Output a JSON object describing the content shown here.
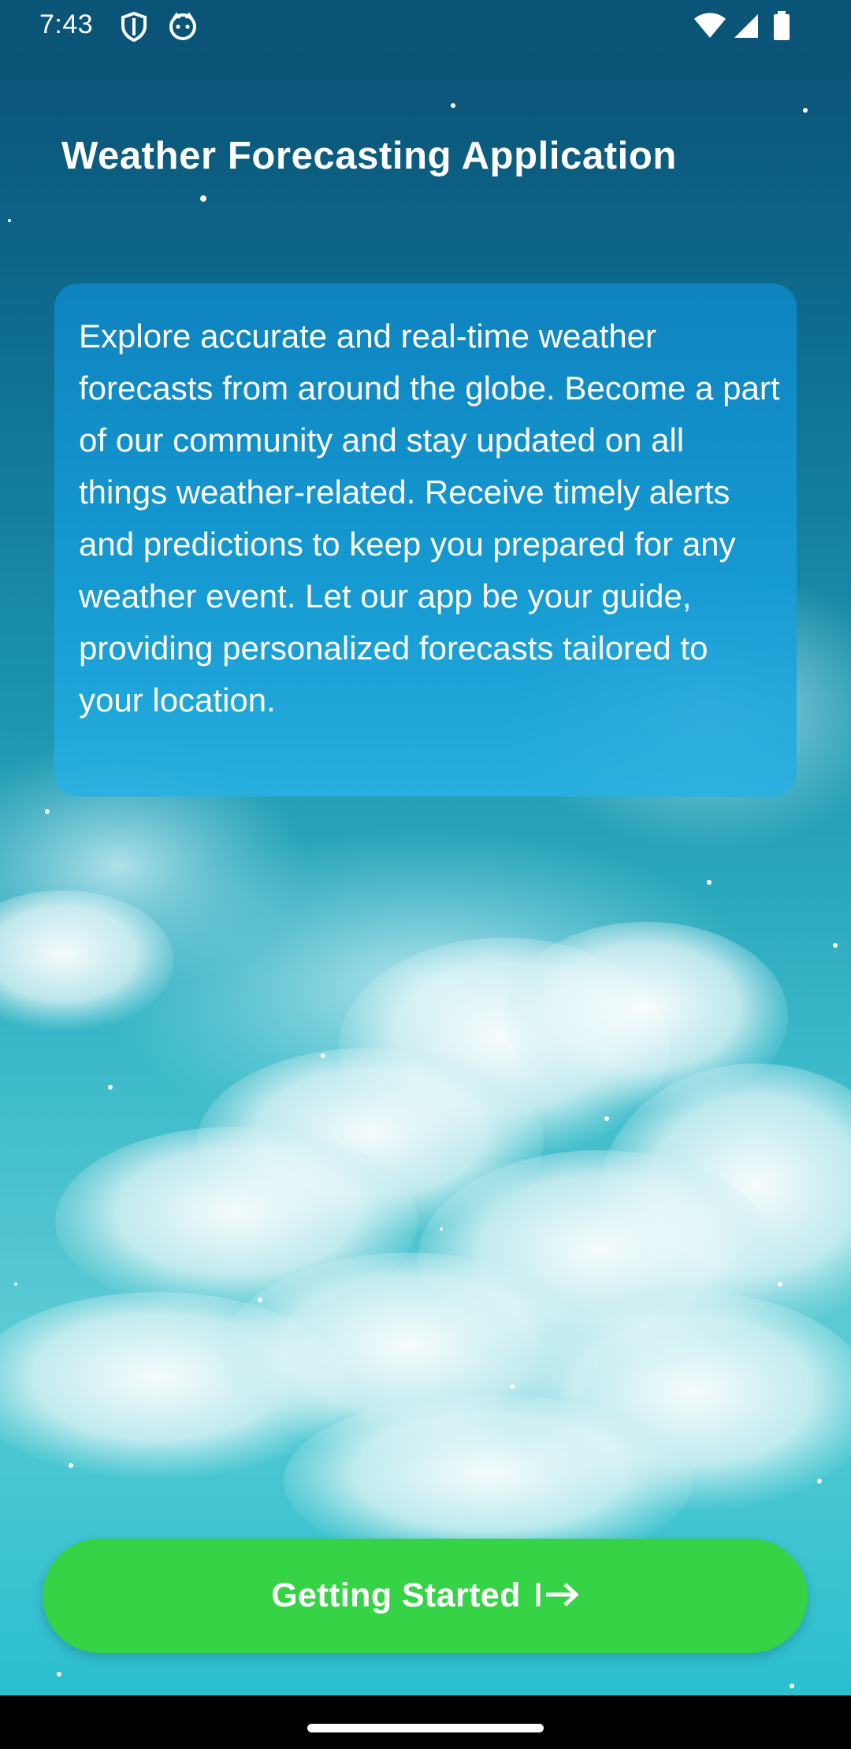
{
  "status_bar": {
    "time": "7:43",
    "left_icons": [
      "shield-icon",
      "face-icon"
    ],
    "right_icons": [
      "wifi-icon",
      "signal-icon",
      "battery-icon"
    ]
  },
  "header": {
    "title": "Weather Forecasting Application"
  },
  "intro_card": {
    "text": "Explore accurate and real-time weather forecasts from around the globe. Become a part of our community and stay updated on all things weather-related. Receive timely alerts and predictions to keep you prepared for any weather event. Let our app be your guide, providing personalized forecasts tailored to your location."
  },
  "cta": {
    "label": "Getting Started",
    "icon": "arrow-right-to-bar-icon",
    "color": "#36d347"
  },
  "colors": {
    "status_bar": "#0a5577",
    "card": "#1496d3",
    "sky_top": "#0a4e73",
    "sky_bottom": "#2bbfcf"
  }
}
